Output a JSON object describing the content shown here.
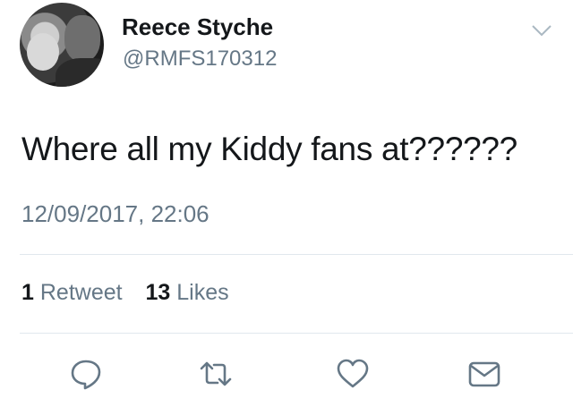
{
  "tweet": {
    "author": {
      "display_name": "Reece Styche",
      "handle": "@RMFS170312"
    },
    "text": "Where all my Kiddy fans at??????",
    "timestamp": "12/09/2017, 22:06",
    "stats": {
      "retweets_count": "1",
      "retweets_label": "Retweet",
      "likes_count": "13",
      "likes_label": "Likes"
    },
    "actions": [
      "reply-icon",
      "retweet-icon",
      "like-icon",
      "direct-message-icon"
    ],
    "menu_icon": "chevron-down-icon"
  },
  "colors": {
    "primary_text": "#14171a",
    "secondary_text": "#657786",
    "divider": "#e1e8ed",
    "icon": "#657786"
  }
}
